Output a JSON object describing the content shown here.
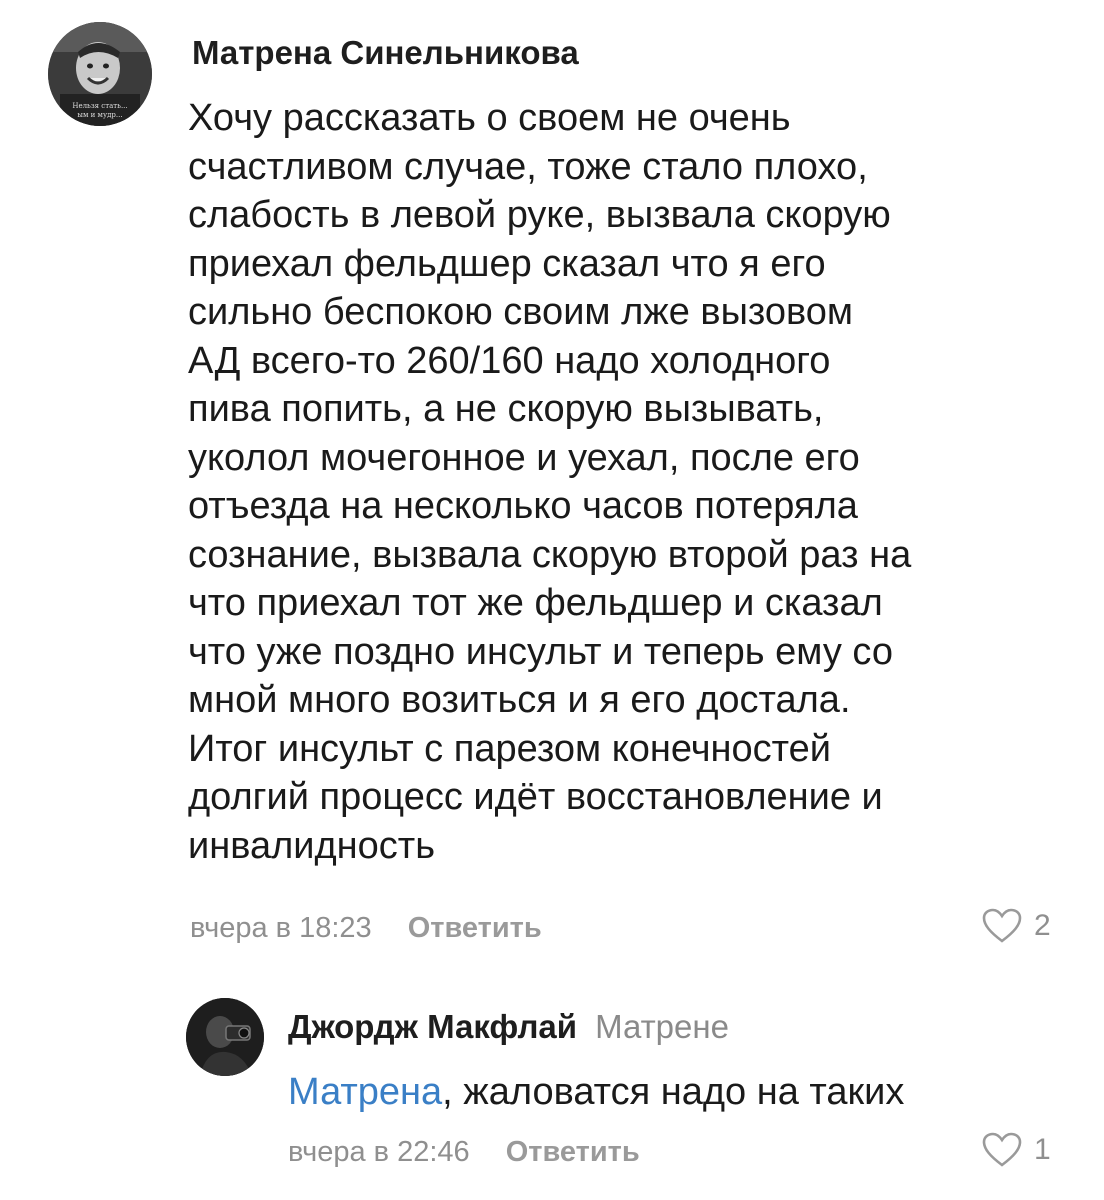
{
  "comments": [
    {
      "author": "Матрена Синельникова",
      "avatar_icon": "child-photo-avatar",
      "avatar_caption": "Нельзя стать... ым и мудр...",
      "text_lines": [
        "Хочу рассказать о своем не очень",
        "счастливом случае, тоже стало плохо,",
        "слабость в левой руке, вызвала скорую",
        "приехал фельдшер сказал что я его",
        "сильно беспокою своим лже вызовом",
        "АД всего-то 260/160 надо холодного",
        "пива попить, а не скорую вызывать,",
        "уколол мочегонное и уехал, после его",
        "отъезда на несколько часов потеряла",
        "сознание, вызвала скорую второй раз на",
        "что приехал тот же фельдшер и сказал",
        "что уже поздно инсульт и теперь ему со",
        "мной много возиться и я его достала.",
        "Итог инсульт с парезом конечностей",
        "долгий процесс идёт восстановление и",
        "инвалидность"
      ],
      "time": "вчера в 18:23",
      "reply_label": "Ответить",
      "like_icon": "heart-outline-icon",
      "likes": "2"
    },
    {
      "author": "Джордж Макфлай",
      "reply_to": "Матрене",
      "avatar_icon": "dark-photo-avatar",
      "mention": "Матрена",
      "text": ", жаловатся надо на таких",
      "time": "вчера в 22:46",
      "reply_label": "Ответить",
      "like_icon": "heart-outline-icon",
      "likes": "1"
    }
  ],
  "colors": {
    "mention": "#3a7fc6",
    "meta": "#8f8f8f",
    "author": "#1e1e1e"
  }
}
